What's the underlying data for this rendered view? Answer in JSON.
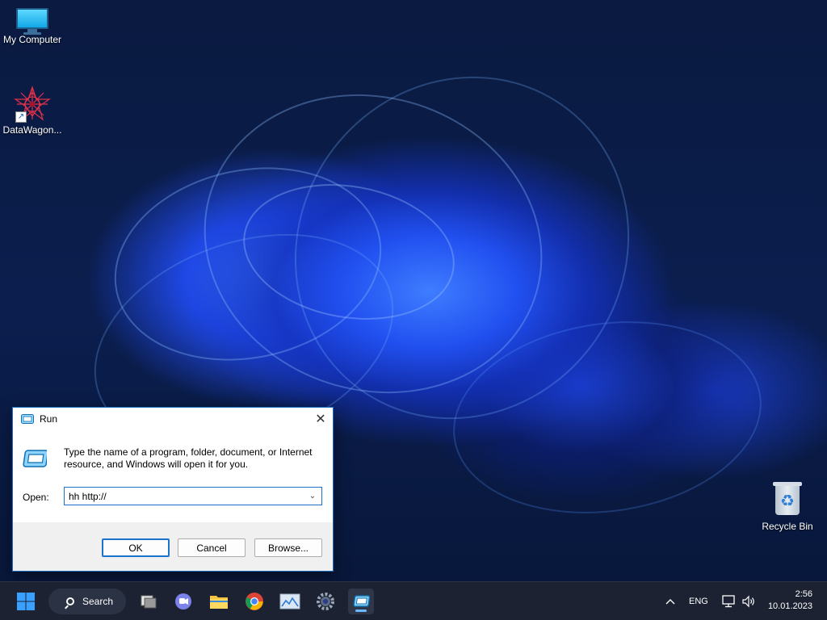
{
  "desktop": {
    "icons": [
      {
        "label": "My Computer"
      },
      {
        "label": "DataWagon..."
      },
      {
        "label": "Recycle Bin"
      }
    ]
  },
  "run_dialog": {
    "title": "Run",
    "description": "Type the name of a program, folder, document, or Internet resource, and Windows will open it for you.",
    "open_label": "Open:",
    "open_value": "hh http://",
    "ok_label": "OK",
    "cancel_label": "Cancel",
    "browse_label": "Browse..."
  },
  "taskbar": {
    "search_label": "Search",
    "language": "ENG",
    "time": "2:56",
    "date": "10.01.2023",
    "icons": [
      "start-icon",
      "search-icon",
      "task-view-icon",
      "chat-icon",
      "file-explorer-icon",
      "chrome-icon",
      "image-app-icon",
      "settings-icon",
      "run-app-icon"
    ]
  },
  "colors": {
    "accent": "#1a73c8",
    "taskbar_bg": "#1c2232",
    "dialog_border": "#1b6fbf"
  }
}
